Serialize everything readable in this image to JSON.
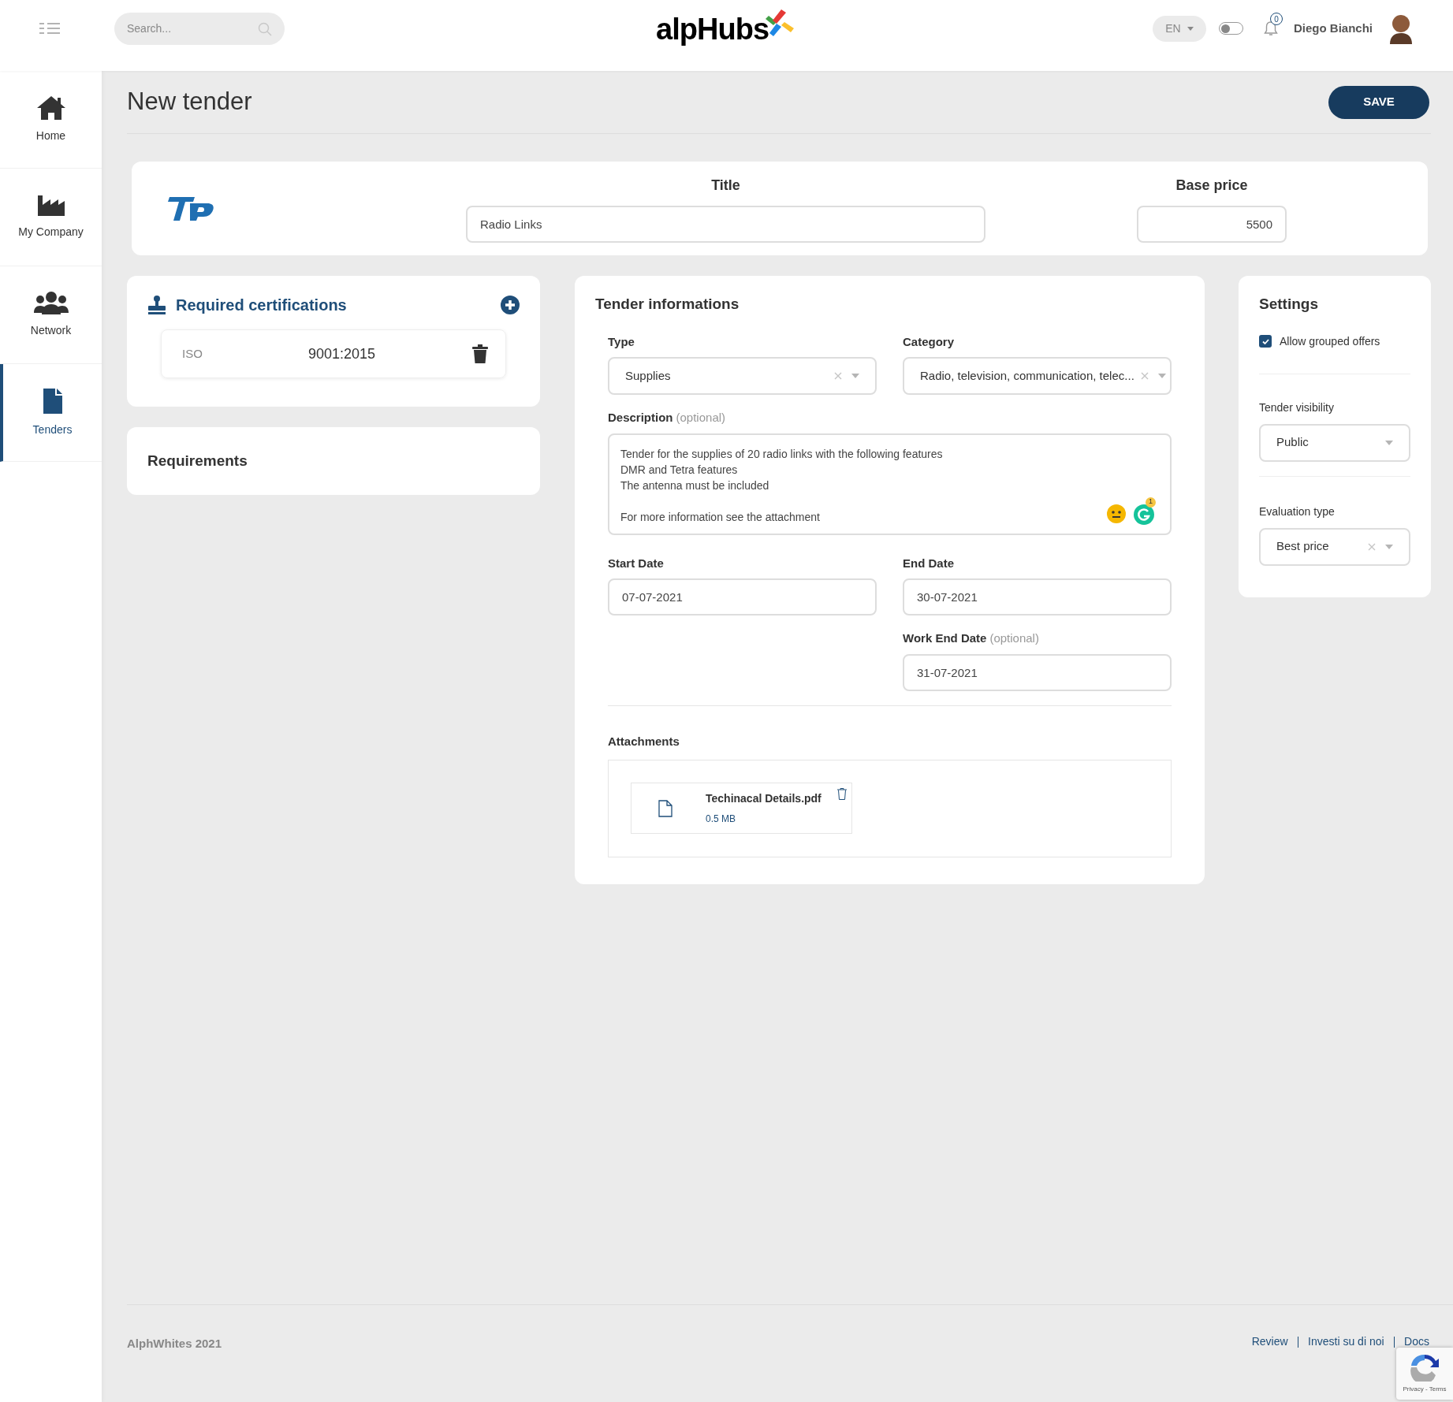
{
  "header": {
    "search": {
      "placeholder": "Search..."
    },
    "logo": "alpHubs",
    "language": "EN",
    "theme_switch": {
      "on": false
    },
    "notifications": "0",
    "user": "Diego Bianchi"
  },
  "sidebar": {
    "items": [
      {
        "label": "Home",
        "kind": "home",
        "selected": false
      },
      {
        "label": "My Company",
        "kind": "company",
        "selected": false
      },
      {
        "label": "Network",
        "kind": "network",
        "selected": false
      },
      {
        "label": "Tenders",
        "kind": "tenders",
        "selected": true
      }
    ]
  },
  "page": {
    "title": "New tender",
    "save_button": "SAVE"
  },
  "summary": {
    "title_label": "Title",
    "title_value": "Radio Links",
    "price_label": "Base price",
    "price_value": "5500"
  },
  "certifications": {
    "title": "Required certifications",
    "items": [
      {
        "kind_label": "ISO",
        "code": "9001:2015"
      }
    ]
  },
  "requirements": {
    "title": "Requirements"
  },
  "tender_info": {
    "title": "Tender informations",
    "type": {
      "label": "Type",
      "value": "Supplies"
    },
    "category": {
      "label": "Category",
      "value": "Radio, television, communication, telec..."
    },
    "description": {
      "label": "Description",
      "optional": "(optional)",
      "paragraphs": [
        [
          "Tender for the supplies of 20 radio links with the following features",
          "DMR and Tetra features",
          "The antenna must be included"
        ],
        [
          "For more information see the attachment"
        ]
      ],
      "grammar_count": "1"
    },
    "start_date": {
      "label": "Start Date",
      "value": "07-07-2021"
    },
    "end_date": {
      "label": "End Date",
      "value": "30-07-2021"
    },
    "work_end_date": {
      "label": "Work End Date",
      "optional": "(optional)",
      "value": "31-07-2021"
    },
    "attachments": {
      "label": "Attachments",
      "files": [
        {
          "name": "Techinacal Details.pdf",
          "size": "0.5 MB"
        }
      ]
    }
  },
  "settings": {
    "title": "Settings",
    "grouped_offers": {
      "label": "Allow grouped offers",
      "checked": true
    },
    "visibility": {
      "label": "Tender visibility",
      "value": "Public"
    },
    "evaluation": {
      "label": "Evaluation type",
      "value": "Best price"
    }
  },
  "footer": {
    "copyright": "AlphWhites 2021",
    "links": [
      "Review",
      "Investi su di noi",
      "Docs"
    ],
    "recaptcha": "Privacy - Terms"
  }
}
